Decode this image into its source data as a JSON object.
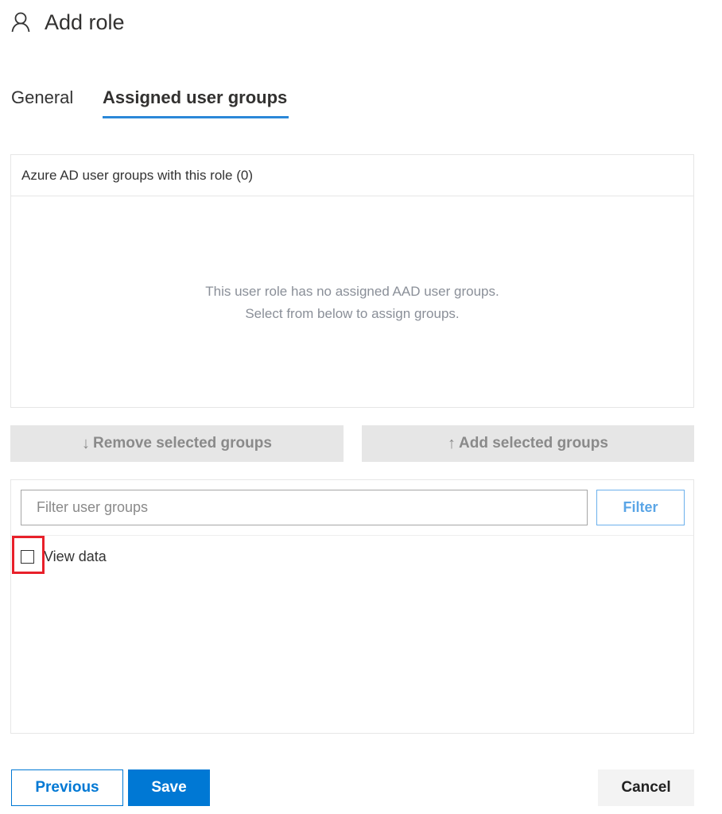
{
  "header": {
    "icon": "person-icon",
    "title": "Add role"
  },
  "tabs": [
    {
      "label": "General",
      "active": false
    },
    {
      "label": "Assigned user groups",
      "active": true
    }
  ],
  "assigned_panel": {
    "header": "Azure AD user groups with this role (0)",
    "count": 0,
    "empty_line1": "This user role has no assigned AAD user groups.",
    "empty_line2": "Select from below to assign groups."
  },
  "actions": {
    "remove": {
      "icon": "arrow-down-icon",
      "glyph": "↓",
      "label": "Remove selected groups",
      "enabled": false
    },
    "add": {
      "icon": "arrow-up-icon",
      "glyph": "↑",
      "label": "Add selected groups",
      "enabled": false
    }
  },
  "available_panel": {
    "filter_placeholder": "Filter user groups",
    "filter_value": "",
    "filter_button": "Filter",
    "items": [
      {
        "label": "View data",
        "checked": false
      }
    ]
  },
  "footer": {
    "previous": "Previous",
    "save": "Save",
    "cancel": "Cancel"
  },
  "colors": {
    "accent": "#0078d4",
    "tab_underline": "#2b88d8",
    "highlight": "#e8202a",
    "disabled_bg": "#e6e6e6"
  }
}
